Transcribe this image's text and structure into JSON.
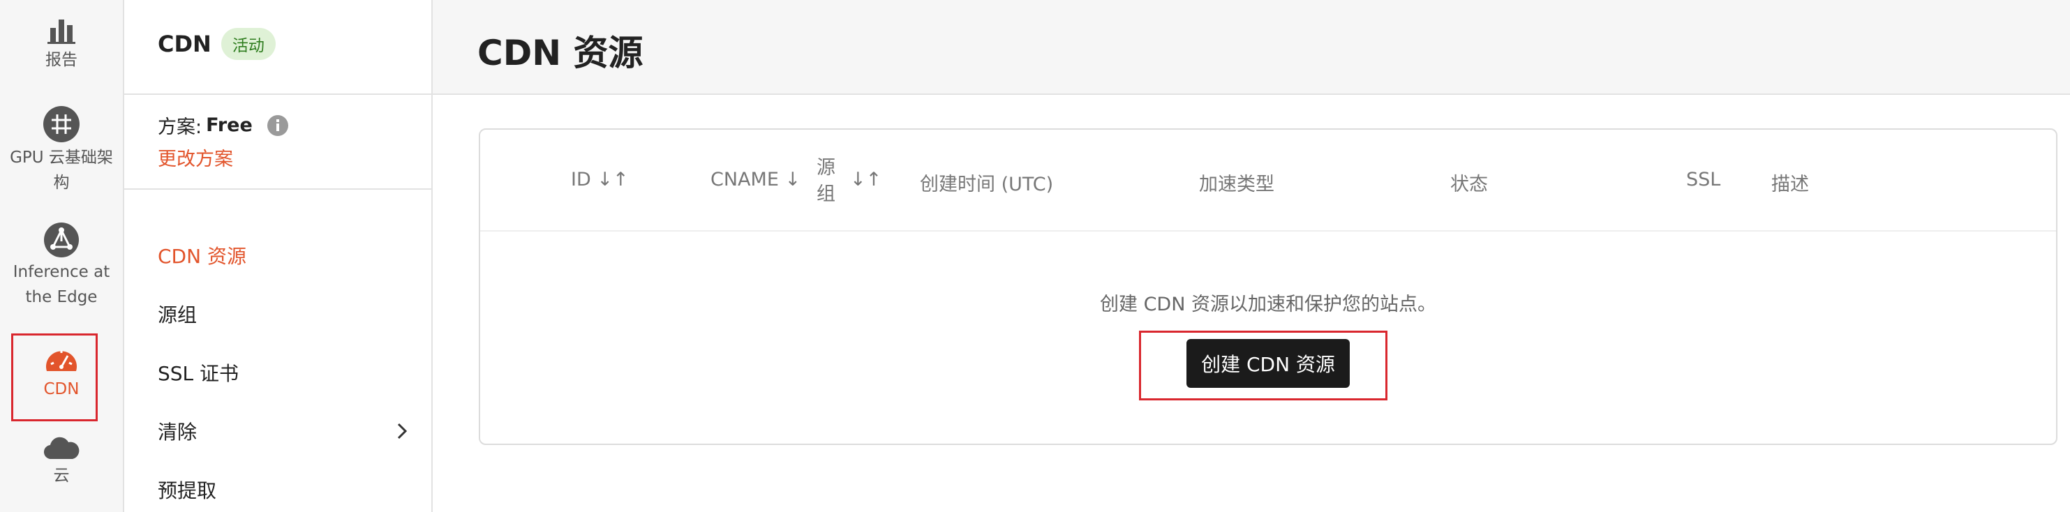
{
  "rail": {
    "items": [
      {
        "label": "报告"
      },
      {
        "label": "GPU 云基础架构"
      },
      {
        "label": "Inference at the Edge"
      },
      {
        "label": "CDN"
      },
      {
        "label": "云"
      }
    ]
  },
  "sidebar": {
    "product_name": "CDN",
    "status_badge": "活动",
    "plan_label": "方案:",
    "plan_value": "Free",
    "change_plan": "更改方案",
    "nav": [
      {
        "label": "CDN 资源"
      },
      {
        "label": "源组"
      },
      {
        "label": "SSL 证书"
      },
      {
        "label": "清除"
      },
      {
        "label": "预提取"
      }
    ]
  },
  "main": {
    "page_title": "CDN 资源",
    "table": {
      "columns": [
        "ID ↓↑",
        "CNAME ↓",
        "源组",
        "↓↑",
        "创建时间 (UTC)",
        "加速类型",
        "状态",
        "SSL",
        "描述"
      ]
    },
    "empty_message": "创建 CDN 资源以加速和保护您的站点。",
    "create_button": "创建 CDN 资源"
  },
  "colors": {
    "accent": "#e2542b",
    "highlight": "#d9272e",
    "badge_bg": "#dff1d6"
  }
}
